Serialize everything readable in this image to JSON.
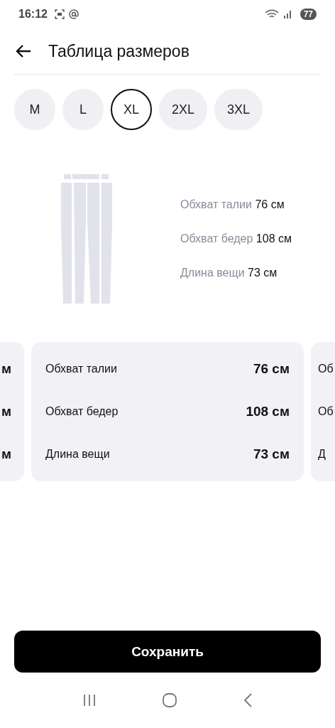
{
  "status_bar": {
    "time": "16:12",
    "battery": "77"
  },
  "header": {
    "title": "Таблица размеров"
  },
  "sizes": [
    {
      "label": "M",
      "selected": false
    },
    {
      "label": "L",
      "selected": false
    },
    {
      "label": "XL",
      "selected": true
    },
    {
      "label": "2XL",
      "selected": false
    },
    {
      "label": "3XL",
      "selected": false
    }
  ],
  "summary": [
    {
      "label": "Обхват талии",
      "value": "76 см"
    },
    {
      "label": "Обхват бедер",
      "value": "108 см"
    },
    {
      "label": "Длина вещи",
      "value": "73 см"
    }
  ],
  "cards": [
    {
      "kind": "left",
      "rows": [
        {
          "value": "м"
        },
        {
          "value": "м"
        },
        {
          "value": "м"
        }
      ]
    },
    {
      "kind": "full",
      "rows": [
        {
          "label": "Обхват талии",
          "value": "76 см"
        },
        {
          "label": "Обхват бедер",
          "value": "108 см"
        },
        {
          "label": "Длина вещи",
          "value": "73 см"
        }
      ]
    },
    {
      "kind": "right",
      "rows": [
        {
          "label": "Об"
        },
        {
          "label": "Об"
        },
        {
          "label": "Д"
        }
      ]
    }
  ],
  "save_button": "Сохранить"
}
